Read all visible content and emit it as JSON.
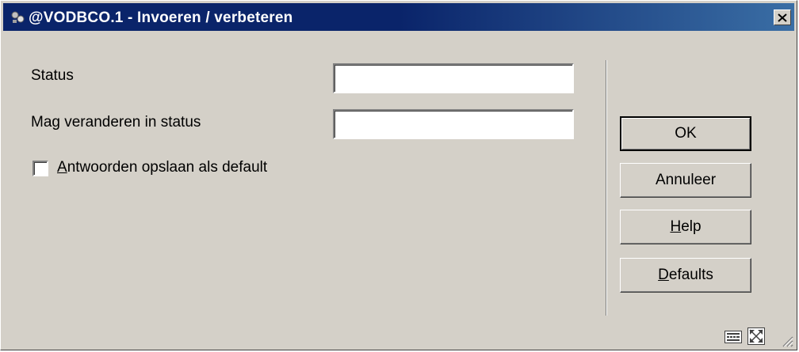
{
  "window": {
    "title": "@VODBCO.1 - Invoeren / verbeteren",
    "icons": {
      "app": "app-icon",
      "close": "close-icon"
    }
  },
  "form": {
    "status": {
      "label": "Status",
      "value": ""
    },
    "mag_veranderen": {
      "label": "Mag veranderen in status",
      "value": ""
    },
    "save_defaults": {
      "mnemonic": "A",
      "label_rest": "ntwoorden opslaan als default",
      "checked": false
    }
  },
  "buttons": {
    "ok": "OK",
    "cancel": "Annuleer",
    "help": {
      "mnemonic": "H",
      "rest": "elp"
    },
    "defaults": {
      "mnemonic": "D",
      "rest": "efaults"
    }
  },
  "statusbar": {
    "icons": [
      "keyboard-icon",
      "maximize-icon",
      "resize-grip-icon"
    ]
  },
  "colors": {
    "title_start": "#0a246a",
    "title_end": "#3a6ea5",
    "face": "#d4d0c8"
  }
}
